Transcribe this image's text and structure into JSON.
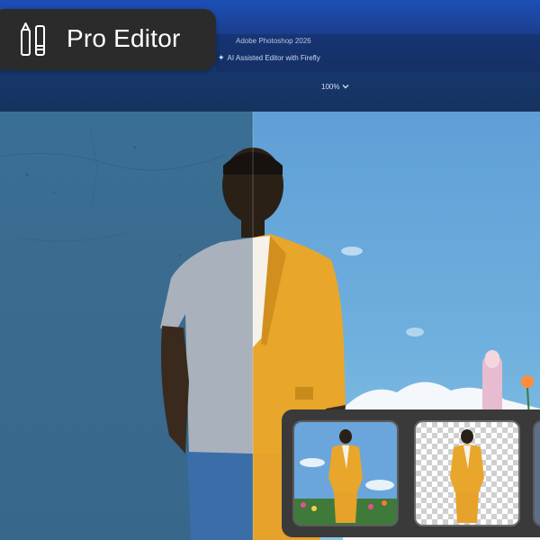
{
  "badge": {
    "label": "Pro Editor",
    "icon": "brush-pencil-icon"
  },
  "app": {
    "name": "Adobe Photoshop 2026",
    "subtitle": "AI Assisted Editor with Firefly",
    "zoom": "100%"
  },
  "colors": {
    "accent_blue": "#1d4fb6",
    "suit_yellow": "#e8a62a",
    "badge_bg": "#2b2b2b",
    "tray_bg": "#3a3a3a"
  },
  "canvas": {
    "left_background": "concrete wall",
    "right_background": "sky with flowers"
  }
}
